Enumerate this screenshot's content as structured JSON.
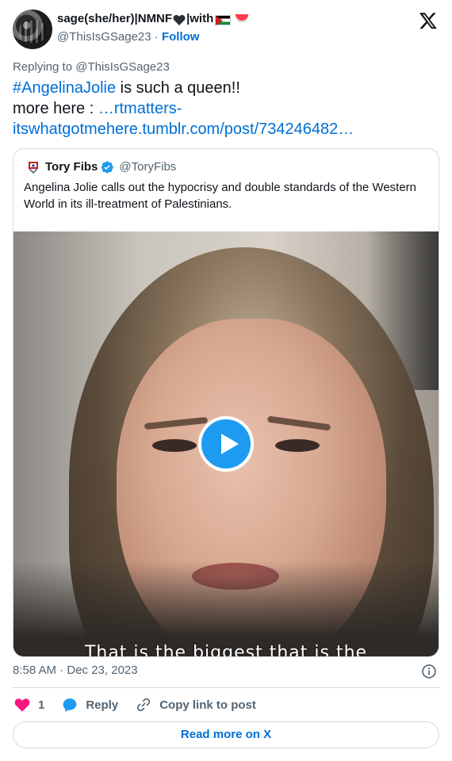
{
  "author": {
    "display_name_prefix": "sage(she/her)|NMNF",
    "display_name_suffix": "|with",
    "handle": "@ThisIsGSage23",
    "separator": "·",
    "follow_label": "Follow"
  },
  "reply_to": "Replying to @ThisIsGSage23",
  "tweet": {
    "hashtag": "#AngelinaJolie",
    "text_after_hashtag": " is such a queen!!",
    "more_prefix": "more here : ",
    "link_line1": "…rtmatters-",
    "link_line2": "itswhatgotmehere.tumblr.com/post/734246482…"
  },
  "quote": {
    "name": "Tory Fibs",
    "handle": "@ToryFibs",
    "text": "Angelina Jolie calls out the hypocrisy and double standards of the Western World in its ill-treatment of Palestinians.",
    "video_caption": "That is the biggest that is the"
  },
  "timestamp": "8:58 AM · Dec 23, 2023",
  "actions": {
    "like_count": "1",
    "reply_label": "Reply",
    "copy_label": "Copy link to post"
  },
  "read_more_label": "Read more on X",
  "icons": {
    "logo": "x-logo-icon",
    "verified": "verified-badge-icon",
    "play": "play-icon",
    "info": "info-icon",
    "like": "heart-icon",
    "reply": "reply-bubble-icon",
    "copy": "link-icon"
  },
  "colors": {
    "link": "#006fd6",
    "secondary_text": "#536471",
    "like": "#f91880",
    "reply": "#1d9bf0",
    "verified": "#1d9bf0"
  }
}
